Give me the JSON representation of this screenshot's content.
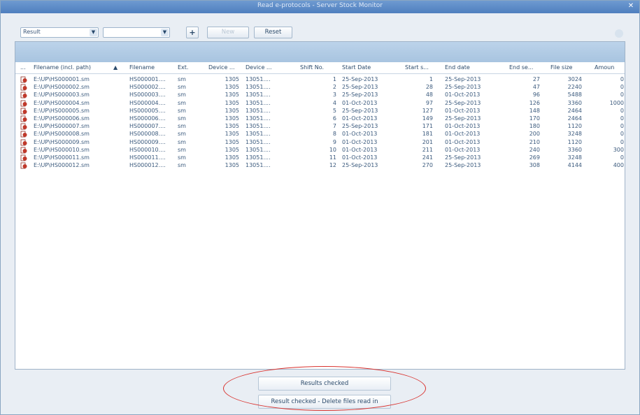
{
  "window": {
    "title": "Read e-protocols - Server Stock Monitor",
    "close_symbol": "✕"
  },
  "toolbar": {
    "filter_field": "Result",
    "filter_value": "",
    "add_symbol": "+",
    "new_label": "New",
    "reset_label": "Reset"
  },
  "table": {
    "columns": [
      "...",
      "Filename (incl. path)",
      "▲",
      "Filename",
      "Ext.",
      "Device ...",
      "Device ...",
      "Shift No.",
      "Start Date",
      "Start s...",
      "End date",
      "End se...",
      "File size",
      "Amoun"
    ],
    "rows": [
      [
        "E:\\UP\\HS000001.sm",
        "HS000001....",
        "sm",
        "1305",
        "13051....",
        "1",
        "25-Sep-2013",
        "1",
        "25-Sep-2013",
        "27",
        "3024",
        "0"
      ],
      [
        "E:\\UP\\HS000002.sm",
        "HS000002....",
        "sm",
        "1305",
        "13051....",
        "2",
        "25-Sep-2013",
        "28",
        "25-Sep-2013",
        "47",
        "2240",
        "0"
      ],
      [
        "E:\\UP\\HS000003.sm",
        "HS000003....",
        "sm",
        "1305",
        "13051....",
        "3",
        "25-Sep-2013",
        "48",
        "01-Oct-2013",
        "96",
        "5488",
        "0"
      ],
      [
        "E:\\UP\\HS000004.sm",
        "HS000004....",
        "sm",
        "1305",
        "13051....",
        "4",
        "01-Oct-2013",
        "97",
        "25-Sep-2013",
        "126",
        "3360",
        "1000"
      ],
      [
        "E:\\UP\\HS000005.sm",
        "HS000005....",
        "sm",
        "1305",
        "13051....",
        "5",
        "25-Sep-2013",
        "127",
        "01-Oct-2013",
        "148",
        "2464",
        "0"
      ],
      [
        "E:\\UP\\HS000006.sm",
        "HS000006....",
        "sm",
        "1305",
        "13051....",
        "6",
        "01-Oct-2013",
        "149",
        "25-Sep-2013",
        "170",
        "2464",
        "0"
      ],
      [
        "E:\\UP\\HS000007.sm",
        "HS000007....",
        "sm",
        "1305",
        "13051....",
        "7",
        "25-Sep-2013",
        "171",
        "01-Oct-2013",
        "180",
        "1120",
        "0"
      ],
      [
        "E:\\UP\\HS000008.sm",
        "HS000008....",
        "sm",
        "1305",
        "13051....",
        "8",
        "01-Oct-2013",
        "181",
        "01-Oct-2013",
        "200",
        "3248",
        "0"
      ],
      [
        "E:\\UP\\HS000009.sm",
        "HS000009....",
        "sm",
        "1305",
        "13051....",
        "9",
        "01-Oct-2013",
        "201",
        "01-Oct-2013",
        "210",
        "1120",
        "0"
      ],
      [
        "E:\\UP\\HS000010.sm",
        "HS000010....",
        "sm",
        "1305",
        "13051....",
        "10",
        "01-Oct-2013",
        "211",
        "01-Oct-2013",
        "240",
        "3360",
        "300"
      ],
      [
        "E:\\UP\\HS000011.sm",
        "HS000011....",
        "sm",
        "1305",
        "13051....",
        "11",
        "01-Oct-2013",
        "241",
        "25-Sep-2013",
        "269",
        "3248",
        "0"
      ],
      [
        "E:\\UP\\HS000012.sm",
        "HS000012....",
        "sm",
        "1305",
        "13051....",
        "12",
        "25-Sep-2013",
        "270",
        "25-Sep-2013",
        "308",
        "4144",
        "400"
      ]
    ]
  },
  "footer": {
    "results_checked_label": "Results checked",
    "delete_label": "Result checked - Delete files read in"
  },
  "colors": {
    "title_bar": "#5a88c6",
    "group_bar": "#b3cde7",
    "highlight_ellipse": "#d9322e",
    "file_icon": "#c0392b"
  }
}
